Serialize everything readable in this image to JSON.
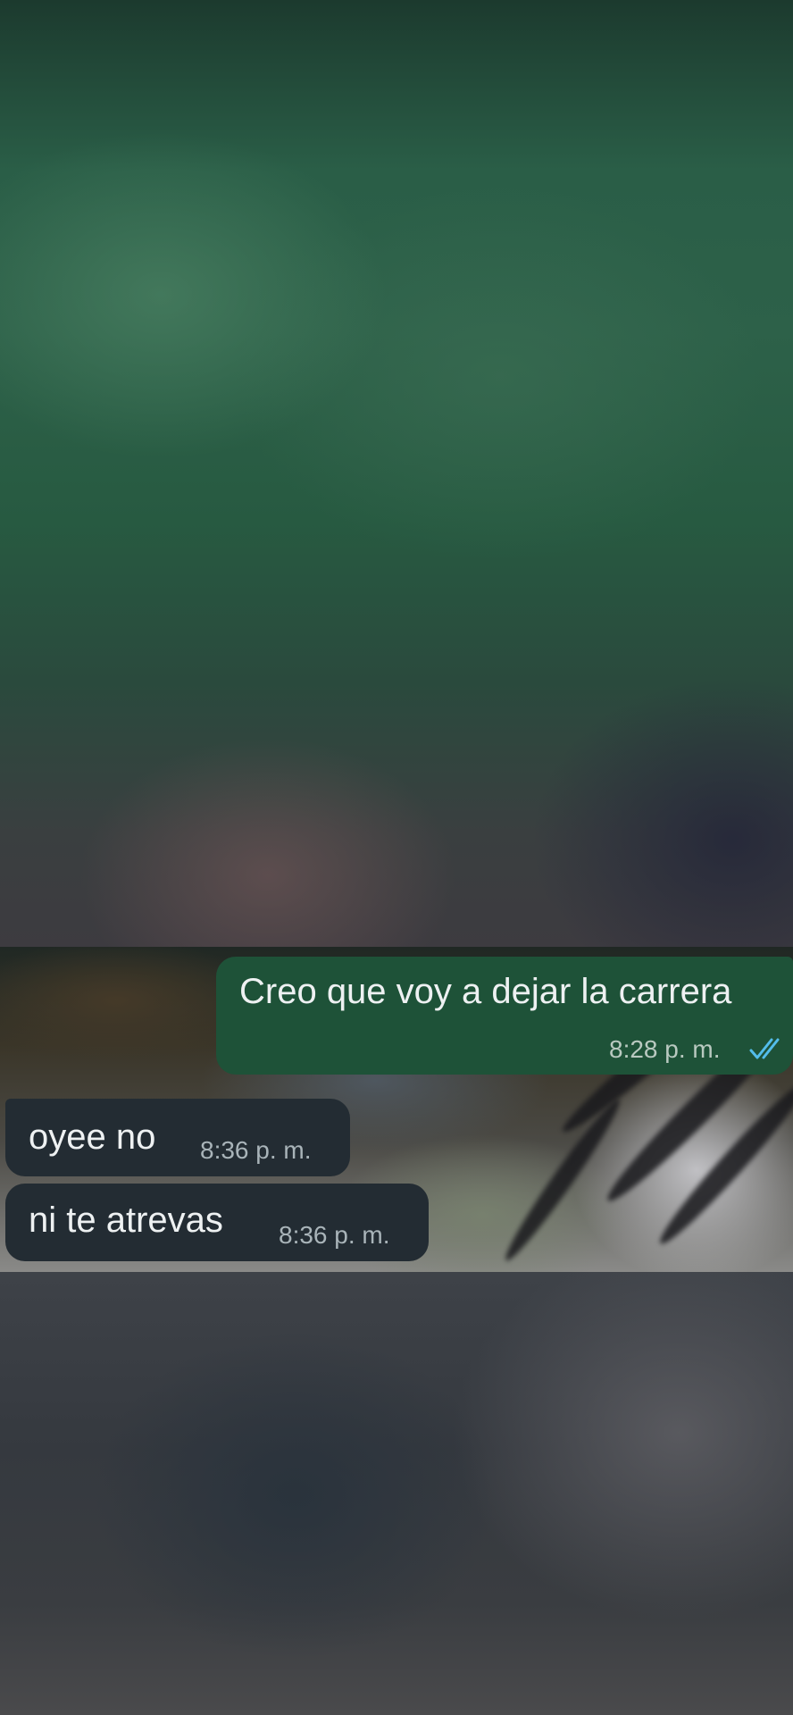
{
  "chat": {
    "messages": [
      {
        "direction": "outgoing",
        "text": "Creo que voy a dejar la carrera",
        "time": "8:28 p. m.",
        "status_icon": "double-check-read-icon",
        "status_color": "#53bdeb"
      },
      {
        "direction": "incoming",
        "text": "oyee no",
        "time": "8:36 p. m."
      },
      {
        "direction": "incoming",
        "text": "ni te atrevas",
        "time": "8:36 p. m."
      }
    ]
  },
  "colors": {
    "outgoing_bubble": "#1e5238",
    "incoming_bubble": "#232c33",
    "read_tick": "#53bdeb"
  }
}
